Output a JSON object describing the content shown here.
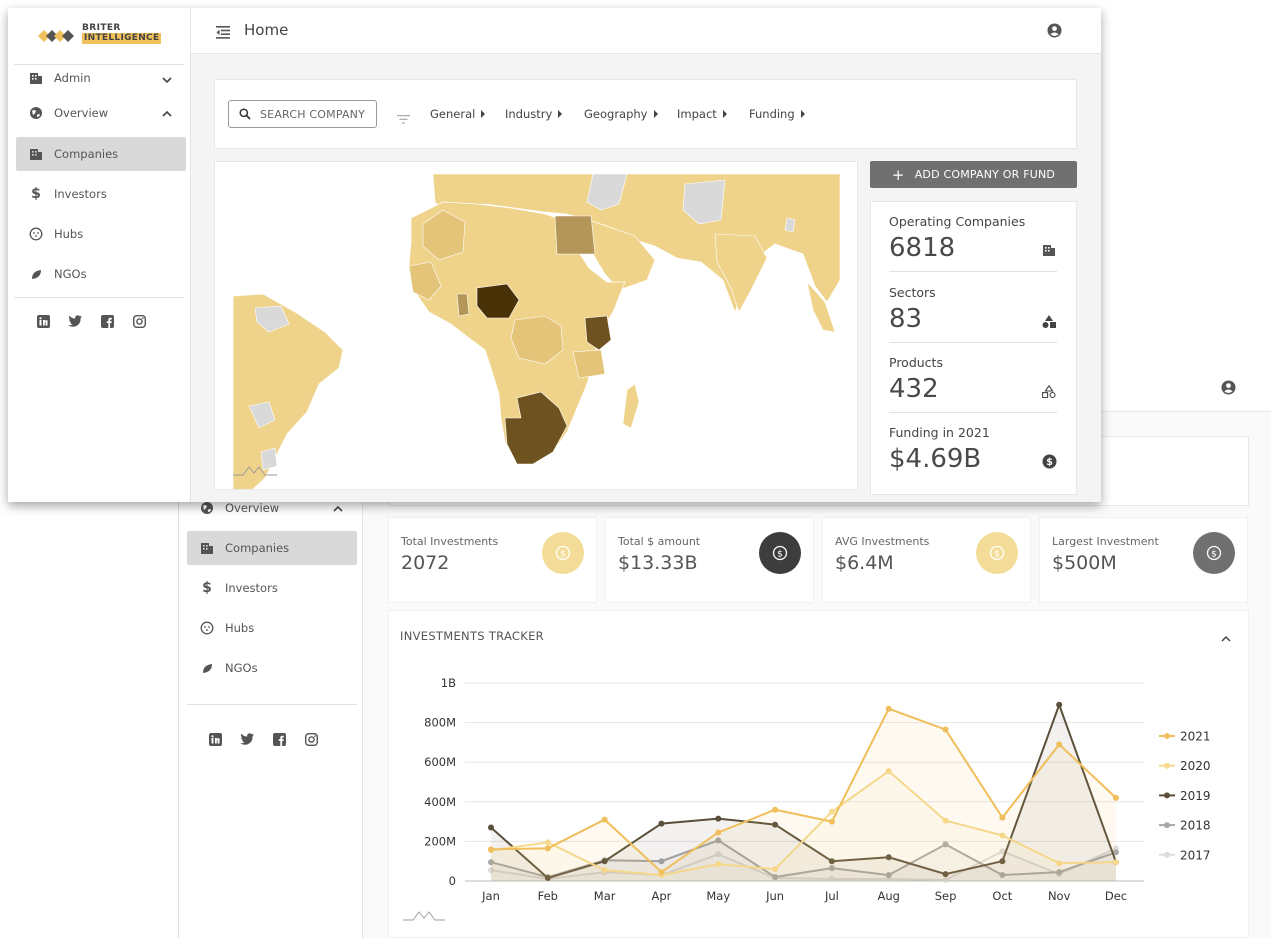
{
  "back": {
    "sidebar": {
      "items": [
        {
          "label": "Overview",
          "icon": "globe-icon"
        },
        {
          "label": "Companies",
          "icon": "building-icon"
        },
        {
          "label": "Investors",
          "icon": "dollar-icon"
        },
        {
          "label": "Hubs",
          "icon": "hub-icon"
        },
        {
          "label": "NGOs",
          "icon": "leaf-icon"
        }
      ]
    },
    "stats": [
      {
        "label": "Total Investments",
        "value": "2072",
        "circle_color": "#f3dc98"
      },
      {
        "label": "Total $ amount",
        "value": "$13.33B",
        "circle_color": "#3d3d3d"
      },
      {
        "label": "AVG Investments",
        "value": "$6.4M",
        "circle_color": "#f3dc98"
      },
      {
        "label": "Largest Investment",
        "value": "$500M",
        "circle_color": "#707070"
      }
    ],
    "tracker_title": "INVESTMENTS TRACKER"
  },
  "front": {
    "logo_line1": "BRITER",
    "logo_line2": "INTELLIGENCE",
    "page_title": "Home",
    "sidebar": {
      "items": [
        {
          "label": "Admin",
          "icon": "building-icon"
        },
        {
          "label": "Overview",
          "icon": "globe-icon"
        },
        {
          "label": "Companies",
          "icon": "building-icon"
        },
        {
          "label": "Investors",
          "icon": "dollar-icon"
        },
        {
          "label": "Hubs",
          "icon": "hub-icon"
        },
        {
          "label": "NGOs",
          "icon": "leaf-icon"
        }
      ]
    },
    "search_label": "SEARCH COMPANY",
    "filters": [
      "General",
      "Industry",
      "Geography",
      "Impact",
      "Funding"
    ],
    "add_button": "ADD COMPANY OR FUND",
    "kpis": [
      {
        "label": "Operating Companies",
        "value": "6818",
        "icon": "building-icon"
      },
      {
        "label": "Sectors",
        "value": "83",
        "icon": "shapes-icon"
      },
      {
        "label": "Products",
        "value": "432",
        "icon": "shapes-outline-icon"
      },
      {
        "label": "Funding in 2021",
        "value": "$4.69B",
        "icon": "dollar-circle-icon"
      }
    ]
  },
  "colors": {
    "accent": "#f0c05a",
    "map_base": "#efd38b",
    "map_dark": "#4a3208"
  },
  "chart_data": {
    "type": "line",
    "categories": [
      "Jan",
      "Feb",
      "Mar",
      "Apr",
      "May",
      "Jun",
      "Jul",
      "Aug",
      "Sep",
      "Oct",
      "Nov",
      "Dec"
    ],
    "y_ticks": [
      "0",
      "200M",
      "400M",
      "600M",
      "800M",
      "1B"
    ],
    "ylim": [
      0,
      1000
    ],
    "y_unit": "M",
    "legend_position": "right",
    "series": [
      {
        "name": "2021",
        "color": "#f0be5a",
        "values": [
          160,
          165,
          310,
          45,
          245,
          360,
          300,
          870,
          765,
          320,
          690,
          420
        ]
      },
      {
        "name": "2020",
        "color": "#f7da8f",
        "values": [
          155,
          195,
          55,
          30,
          85,
          60,
          350,
          555,
          305,
          230,
          90,
          95
        ]
      },
      {
        "name": "2019",
        "color": "#5a4f3a",
        "values": [
          270,
          15,
          100,
          290,
          315,
          285,
          100,
          120,
          35,
          100,
          890,
          95
        ]
      },
      {
        "name": "2018",
        "color": "#a8a8a8",
        "values": [
          95,
          20,
          105,
          100,
          205,
          20,
          65,
          30,
          185,
          30,
          45,
          145
        ]
      },
      {
        "name": "2017",
        "color": "#dddddd",
        "values": [
          55,
          10,
          45,
          30,
          135,
          15,
          10,
          10,
          5,
          150,
          35,
          165
        ]
      }
    ]
  }
}
